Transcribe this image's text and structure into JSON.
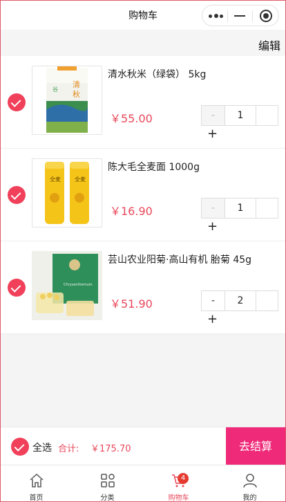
{
  "titlebar": {
    "title": "购物车"
  },
  "editbar": {
    "edit_label": "编辑"
  },
  "items": [
    {
      "name": "清水秋米（绿袋） 5kg",
      "price": "￥55.00",
      "qty": "1",
      "minus": "-",
      "plus": "+"
    },
    {
      "name": "陈大毛全麦面 1000g",
      "price": "￥16.90",
      "qty": "1",
      "minus": "-",
      "plus": "+"
    },
    {
      "name": "芸山农业阳菊·高山有机 胎菊 45g",
      "price": "￥51.90",
      "qty": "2",
      "minus": "-",
      "plus": "+"
    }
  ],
  "footer": {
    "select_all": "全选",
    "total_label": "合计:",
    "total_value": "￥175.70",
    "checkout_label": "去结算"
  },
  "tabbar": {
    "tabs": [
      {
        "label": "首页",
        "icon": "home-icon"
      },
      {
        "label": "分类",
        "icon": "category-icon"
      },
      {
        "label": "购物车",
        "icon": "cart-icon",
        "badge": "4",
        "active": true
      },
      {
        "label": "我的",
        "icon": "user-icon"
      }
    ]
  },
  "colors": {
    "accent": "#e8475a",
    "checkout": "#ef2a79",
    "badge": "#e53a2f"
  }
}
